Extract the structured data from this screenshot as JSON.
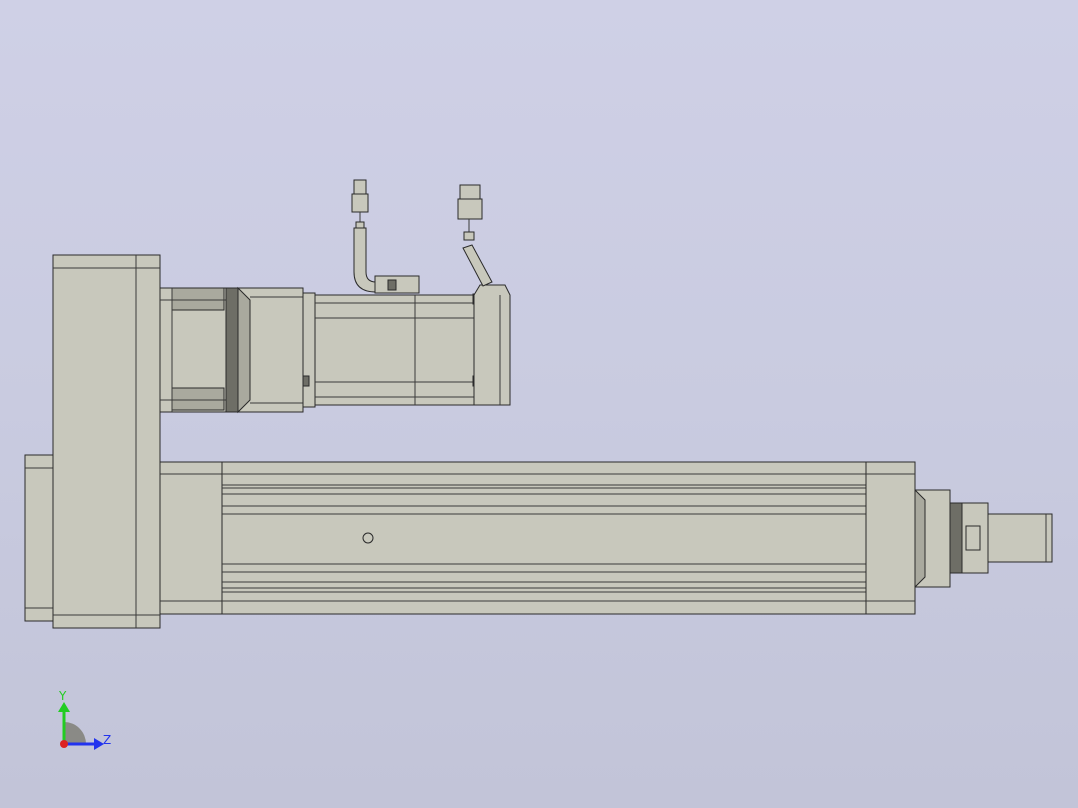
{
  "viewport": {
    "background_top": "#cfd0e6",
    "background_bottom": "#c2c4d8",
    "model_color": "#c8c8bc"
  },
  "triad": {
    "y_label": "Y",
    "z_label": "Z",
    "y_color": "#22cc22",
    "z_color": "#2233ee",
    "x_color": "#dd2222"
  }
}
